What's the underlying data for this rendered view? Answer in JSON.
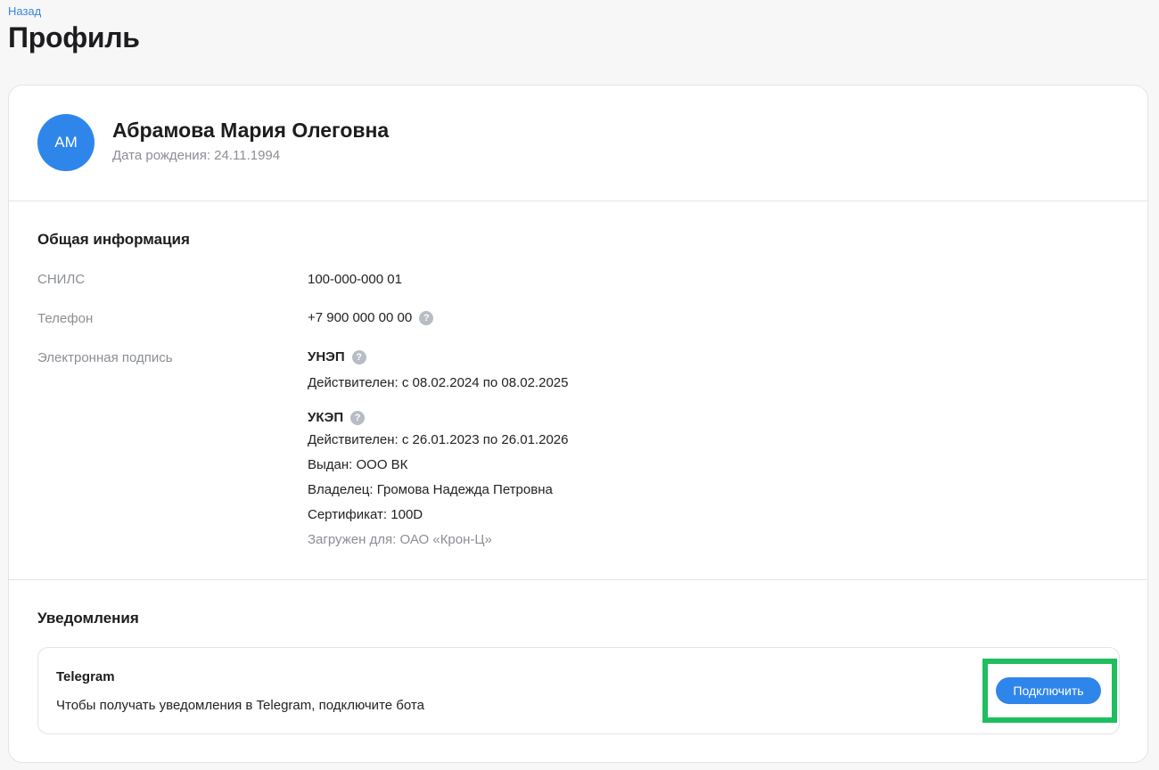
{
  "nav": {
    "back_label": "Назад"
  },
  "page": {
    "title": "Профиль"
  },
  "profile": {
    "initials": "АМ",
    "full_name": "Абрамова Мария Олеговна",
    "birth_date": "Дата рождения: 24.11.1994",
    "avatar_color": "#2f86ea"
  },
  "general_info": {
    "title": "Общая информация",
    "snils_label": "СНИЛС",
    "snils_value": "100-000-000 01",
    "phone_label": "Телефон",
    "phone_value": "+7 900 000 00 00",
    "signature_label": "Электронная подпись",
    "unep": {
      "name": "УНЭП",
      "validity": "Действителен: с 08.02.2024 по 08.02.2025"
    },
    "ukep": {
      "name": "УКЭП",
      "validity": "Действителен: с 26.01.2023 по 26.01.2026",
      "issuer": "Выдан: ООО ВК",
      "owner": "Владелец: Громова Надежда Петровна",
      "certificate": "Сертификат: 100D",
      "uploaded_for": "Загружен для: ОАО «Крон-Ц»"
    }
  },
  "notifications": {
    "title": "Уведомления",
    "telegram": {
      "title": "Telegram",
      "description": "Чтобы получать уведомления в Telegram, подключите бота",
      "button_label": "Подключить"
    }
  },
  "icons": {
    "help": "question-circle-icon"
  },
  "colors": {
    "accent": "#2f86ea",
    "highlight": "#1dbf5e",
    "muted_text": "#8b8e94"
  }
}
